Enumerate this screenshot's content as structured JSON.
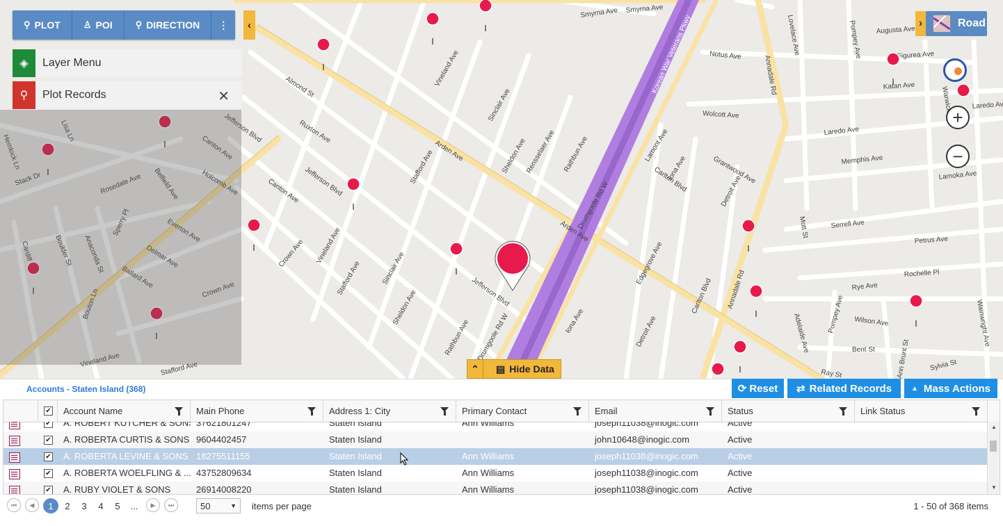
{
  "toolbar": {
    "plot_label": "PLOT",
    "poi_label": "POI",
    "direction_label": "DIRECTION",
    "more_icon": "more-vertical-icon"
  },
  "panels": {
    "layer_menu_label": "Layer Menu",
    "plot_records_label": "Plot Records",
    "layer_color": "#1e8a3a",
    "plot_color": "#d0342c"
  },
  "map": {
    "road_label": "Road",
    "hide_data_label": "Hide Data",
    "street_labels": [
      "Smyrna Ave",
      "Smyrna Ave",
      "Augusta Ave",
      "Notus Ave",
      "Figurea Ave",
      "Katan Ave",
      "Laredo Ave",
      "Wolcott Ave",
      "Laredo Ave",
      "Memphis Ave",
      "Lamoka Ave",
      "Serrell Ave",
      "Petrus Ave",
      "Serrell Ave",
      "Rochelle Pl",
      "Rye Ave",
      "Wilson Ave",
      "Bent St",
      "Sylvia St",
      "Ray St",
      "Arden Ave",
      "Arden Ave",
      "Almond St",
      "Ruxton Ave",
      "Jefferson Blvd",
      "Jefferson Blvd",
      "Jefferson Blvd",
      "Canton Ave",
      "Holcomb Ave",
      "Rosedale Ave",
      "Everton Ave",
      "Delmar Ave",
      "Ballard Ave",
      "Crown Ave",
      "Crown Ave",
      "Vineland Ave",
      "Vineland Ave",
      "Vineland Ave",
      "Stafford Ave",
      "Stafford Ave",
      "Stafford Ave",
      "Sinclair Ave",
      "Sinclair Ave",
      "Sheldon Ave",
      "Sheldon Ave",
      "Rensselaer Ave",
      "Rathbun Ave",
      "Rathbun Ave",
      "Drumgoole Rd W",
      "Drumgoole Rd W",
      "Korean War Veterans Pkwy",
      "Lamont Ave",
      "Carlton Blvd",
      "Carlton Blvd",
      "Iona Ave",
      "Iona Ave",
      "Grantwood Ave",
      "Detroit Ave",
      "Detroit Ave",
      "Edgegrove Ave",
      "Annadale Rd",
      "Annadale Rd",
      "Mott St",
      "Pompey Ave",
      "Pompey Ave",
      "Lovelace Ave",
      "Warwick Ave",
      "Wainwright Ave",
      "Stack Dr",
      "Lisa Ln",
      "Hemlock Ln",
      "Cardiff St",
      "Boulder St",
      "Anaconda St",
      "Sperry Pl",
      "Bouton Ln",
      "Belfield Ave",
      "Ann Brunt St",
      "Adelaide Ave"
    ]
  },
  "grid": {
    "title": "Accounts - Staten Island (368)",
    "buttons": {
      "reset": "Reset",
      "related": "Related Records",
      "mass": "Mass Actions"
    },
    "columns": [
      "Account Name",
      "Main Phone",
      "Address 1: City",
      "Primary Contact",
      "Email",
      "Status",
      "Link Status"
    ],
    "rows": [
      {
        "name": "A. ROBERT KUTCHER & SONS",
        "phone": "37621801247",
        "city": "Staten Island",
        "contact": "Ann Williams",
        "email": "joseph11038@inogic.com",
        "status": "Active",
        "link": ""
      },
      {
        "name": "A. ROBERTA CURTIS & SONS",
        "phone": "9604402457",
        "city": "Staten Island",
        "contact": "",
        "email": "john10648@inogic.com",
        "status": "Active",
        "link": ""
      },
      {
        "name": "A. ROBERTA LEVINE & SONS",
        "phone": "18275511155",
        "city": "Staten Island",
        "contact": "Ann Williams",
        "email": "joseph11038@inogic.com",
        "status": "Active",
        "link": ""
      },
      {
        "name": "A. ROBERTA WOELFLING & ...",
        "phone": "43752809634",
        "city": "Staten Island",
        "contact": "Ann Williams",
        "email": "joseph11038@inogic.com",
        "status": "Active",
        "link": ""
      },
      {
        "name": "A. RUBY VIOLET & SONS",
        "phone": "26914008220",
        "city": "Staten Island",
        "contact": "Ann Williams",
        "email": "joseph11038@inogic.com",
        "status": "Active",
        "link": ""
      }
    ],
    "selected_row": 2
  },
  "pager": {
    "pages": [
      "1",
      "2",
      "3",
      "4",
      "5",
      "..."
    ],
    "active_page": "1",
    "page_size": "50",
    "items_per_page": "items per page",
    "summary": "1 - 50 of 368 items"
  },
  "colors": {
    "toolbar": "#5a8bc5",
    "accent": "#f2b83b",
    "button_blue": "#1f8fe6",
    "selected_row": "#b8cfe6",
    "pin": "#e81a4b"
  }
}
